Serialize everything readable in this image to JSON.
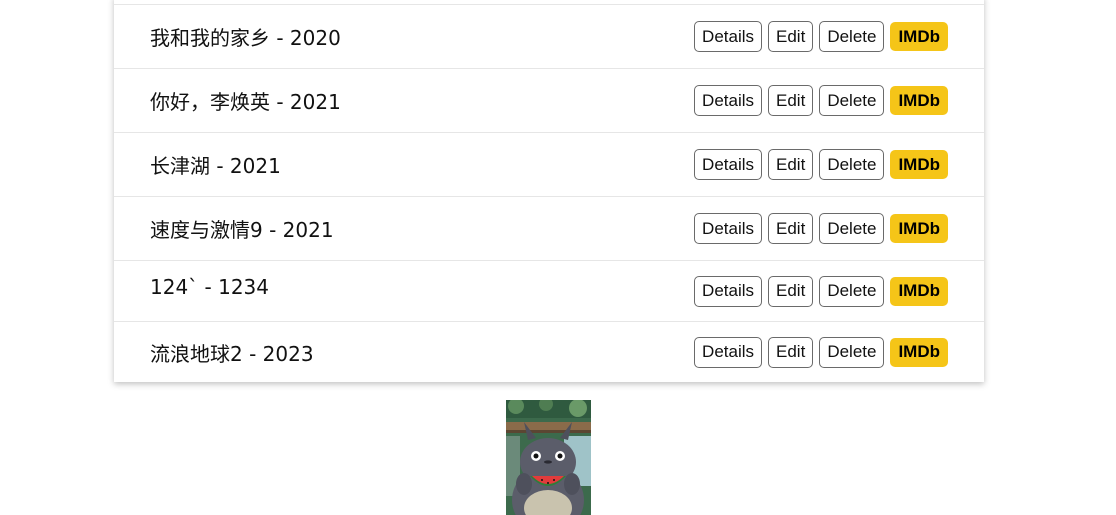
{
  "movies": [
    {
      "title": "我和我的家乡 - 2020"
    },
    {
      "title": "你好，李焕英 - 2021"
    },
    {
      "title": "长津湖 - 2021"
    },
    {
      "title": "速度与激情9 - 2021"
    },
    {
      "title": "124` - 1234"
    },
    {
      "title": "流浪地球2 - 2023"
    }
  ],
  "actions": {
    "details_label": "Details",
    "edit_label": "Edit",
    "delete_label": "Delete",
    "imdb_label": "IMDb"
  },
  "colors": {
    "imdb_bg": "#f5c518",
    "border": "#6a6a6a",
    "divider": "#e6e6e6"
  },
  "image": {
    "subject": "totoro-eating-watermelon"
  }
}
